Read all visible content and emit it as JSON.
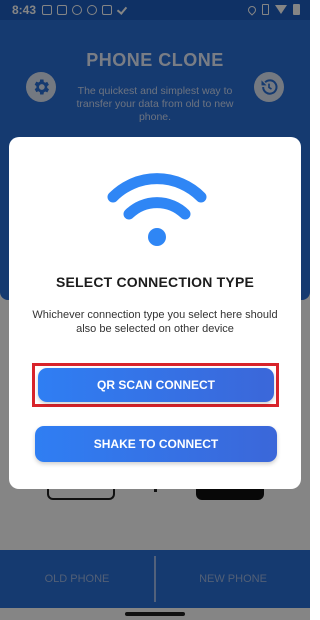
{
  "status_bar": {
    "time": "8:43"
  },
  "app": {
    "title": "PHONE CLONE",
    "subtitle": "The quickest and simplest way to transfer your data from old to new phone.",
    "settings_icon": "gear-icon",
    "history_icon": "history-icon"
  },
  "bottom_nav": {
    "old_phone": "OLD PHONE",
    "new_phone": "NEW PHONE"
  },
  "dialog": {
    "icon": "wifi-icon",
    "title": "SELECT CONNECTION TYPE",
    "message": "Whichever connection type you select here should also be selected on other device",
    "qr_button": "QR SCAN CONNECT",
    "shake_button": "SHAKE TO CONNECT"
  },
  "colors": {
    "primary": "#2a6fd6",
    "button": "#2f7ef3",
    "wifi_icon": "#2f86f5",
    "highlight": "#d8232a"
  }
}
